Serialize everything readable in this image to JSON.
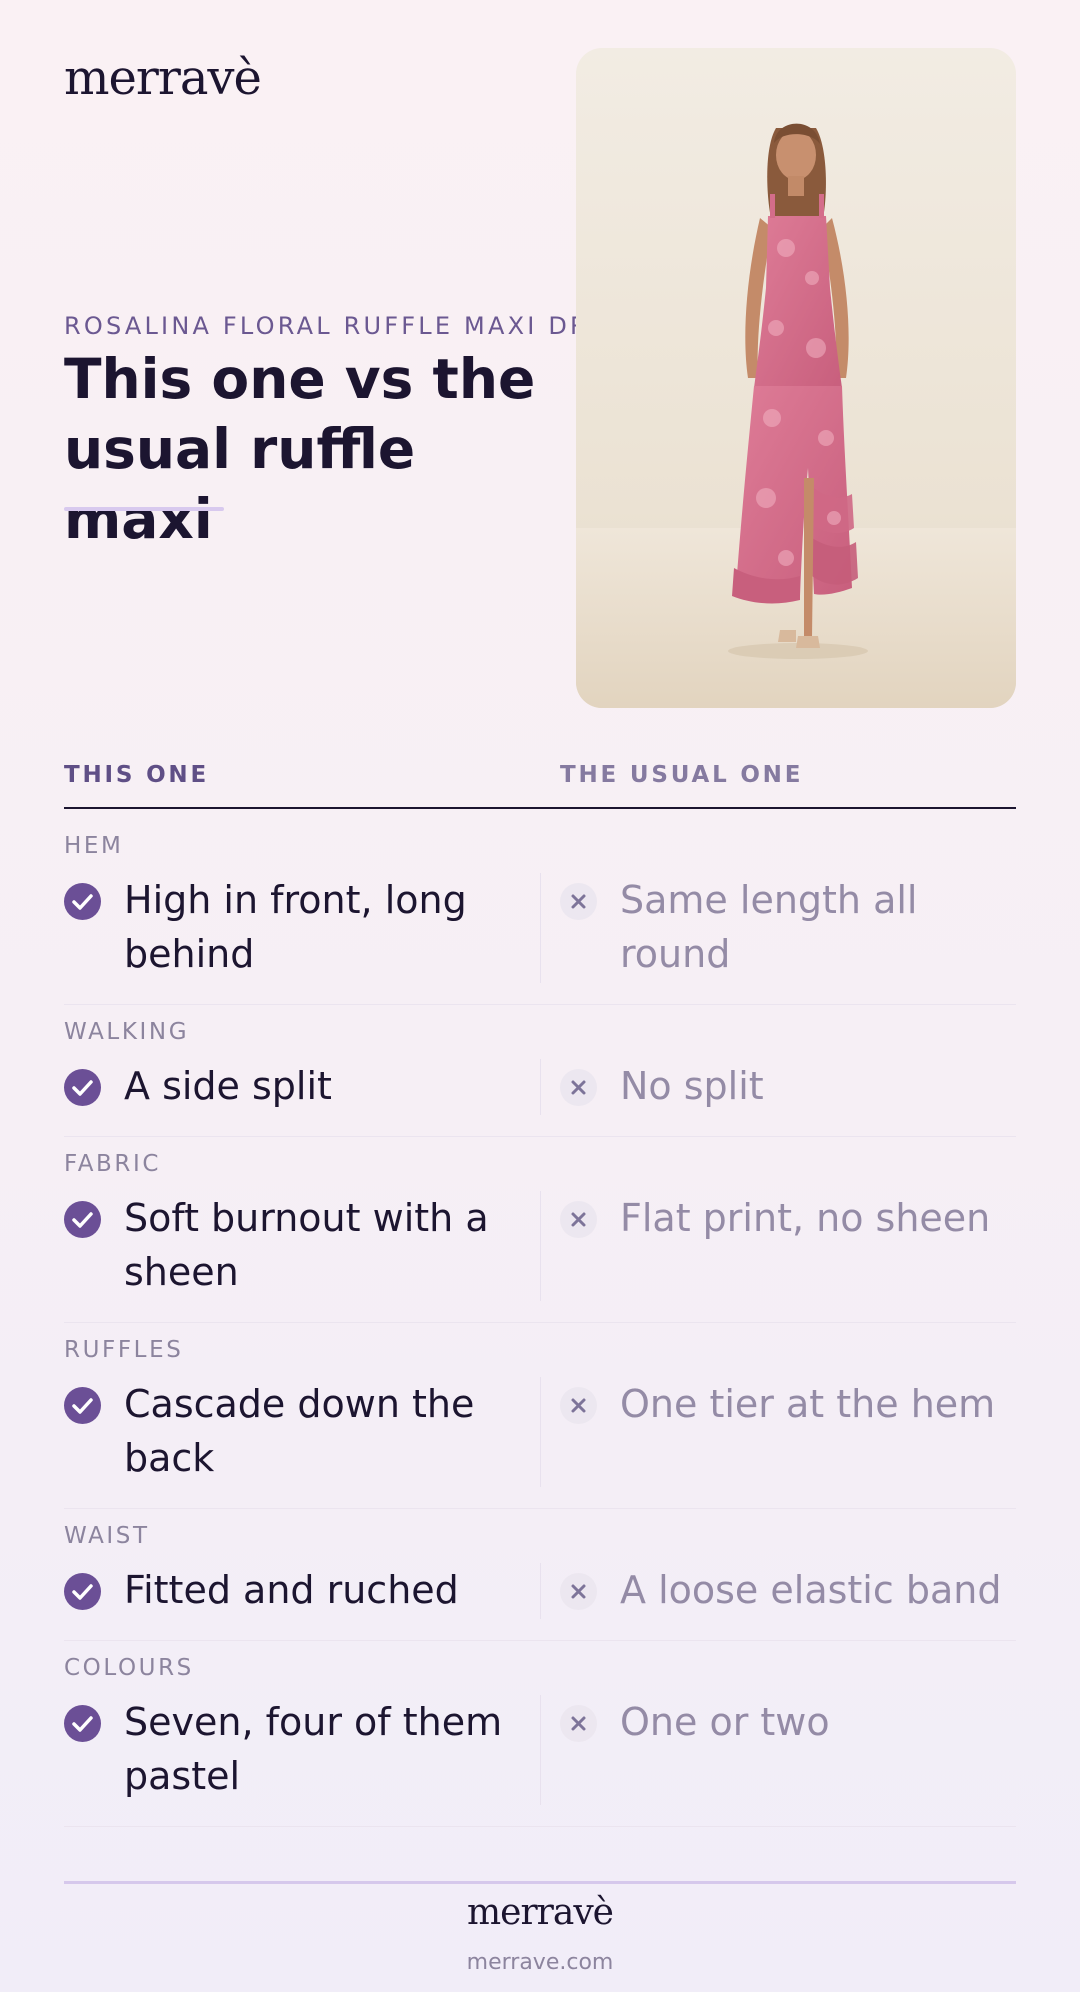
{
  "brand": {
    "logo": "merravè",
    "url": "merrave.com"
  },
  "hero": {
    "eyebrow": "ROSALINA FLORAL RUFFLE MAXI DRESS",
    "title": "This one vs the usual ruffle maxi",
    "photo_alt": "model wearing pink floral ruffle maxi dress"
  },
  "table": {
    "col_left": "THIS ONE",
    "col_right": "THE USUAL ONE",
    "rows": [
      {
        "label": "HEM",
        "good": "High in front, long behind",
        "bad": "Same length all round"
      },
      {
        "label": "WALKING",
        "good": "A side split",
        "bad": "No split"
      },
      {
        "label": "FABRIC",
        "good": "Soft burnout with a sheen",
        "bad": "Flat print, no sheen"
      },
      {
        "label": "RUFFLES",
        "good": "Cascade down the back",
        "bad": "One tier at the hem"
      },
      {
        "label": "WAIST",
        "good": "Fitted and ruched",
        "bad": "A loose elastic band"
      },
      {
        "label": "COLOURS",
        "good": "Seven, four of them pastel",
        "bad": "One or two"
      }
    ]
  },
  "colors": {
    "accent": "#6b4f96",
    "muted": "#948ba6",
    "dress": "#d9738f"
  }
}
